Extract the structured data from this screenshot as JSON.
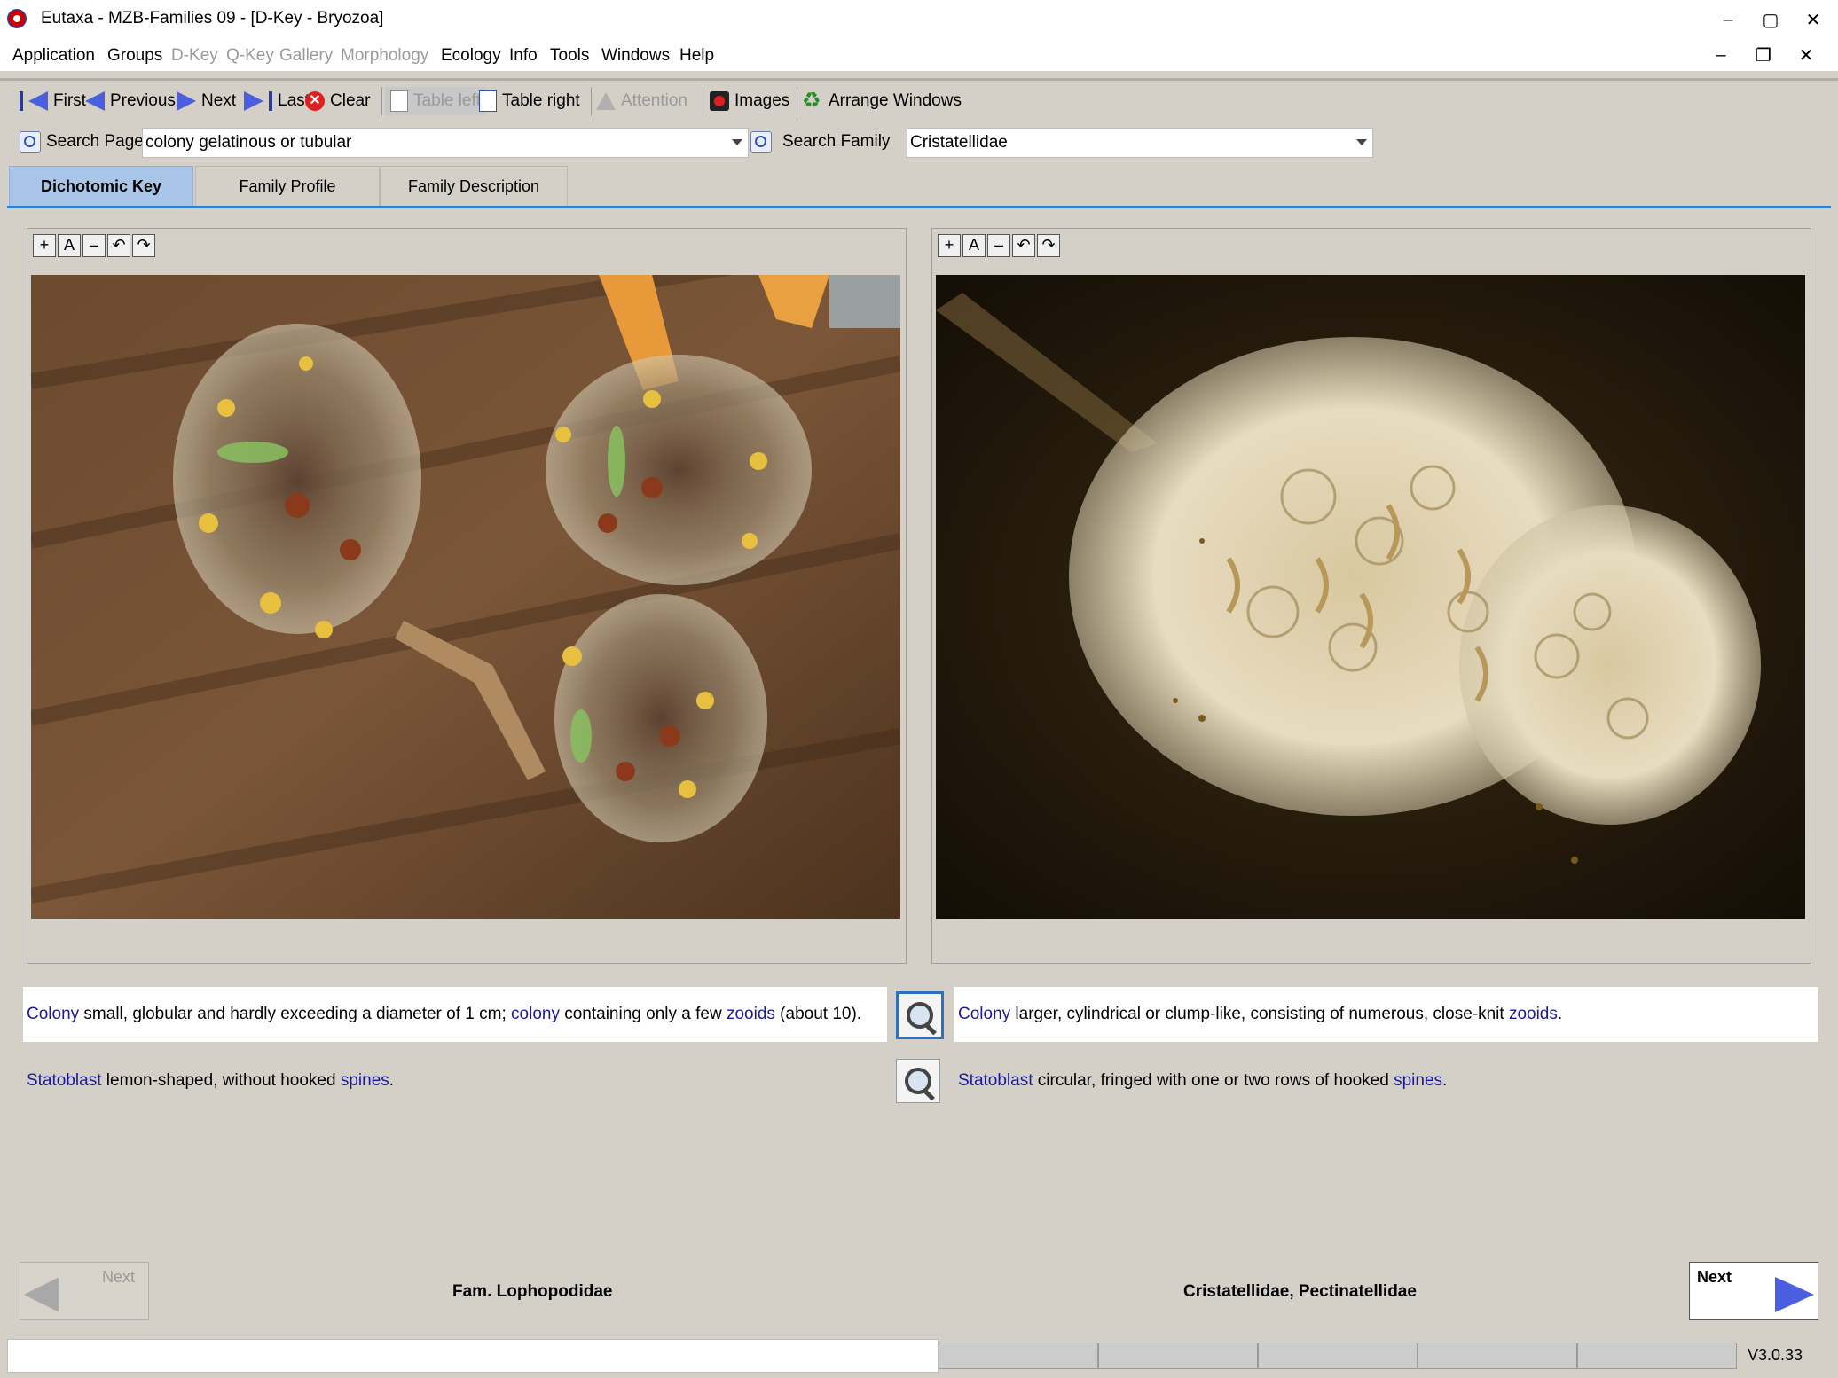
{
  "window": {
    "title": "Eutaxa - MZB-Families 09 - [D-Key - Bryozoa]",
    "minimize": "–",
    "maximize": "▢",
    "close": "✕",
    "mdi_minimize": "–",
    "mdi_restore": "❐",
    "mdi_close": "✕"
  },
  "menu": {
    "items": [
      {
        "label": "Application",
        "enabled": true
      },
      {
        "label": "Groups",
        "enabled": true
      },
      {
        "label": "D-Key",
        "enabled": false
      },
      {
        "label": "Q-Key",
        "enabled": false
      },
      {
        "label": "Gallery",
        "enabled": false
      },
      {
        "label": "Morphology",
        "enabled": false
      },
      {
        "label": "Ecology",
        "enabled": true
      },
      {
        "label": "Info",
        "enabled": true
      },
      {
        "label": "Tools",
        "enabled": true
      },
      {
        "label": "Windows",
        "enabled": true
      },
      {
        "label": "Help",
        "enabled": true
      }
    ]
  },
  "toolbar": {
    "first": "First",
    "previous": "Previous",
    "next": "Next",
    "last": "Last",
    "clear": "Clear",
    "table_left": "Table left",
    "table_right": "Table right",
    "attention": "Attention",
    "images": "Images",
    "arrange_windows": "Arrange Windows"
  },
  "search": {
    "page_label": "Search Page",
    "page_value": "colony gelatinous or tubular",
    "family_label": "Search Family",
    "family_value": "Cristatellidae"
  },
  "tabs": [
    {
      "label": "Dichotomic Key",
      "active": true
    },
    {
      "label": "Family Profile",
      "active": false
    },
    {
      "label": "Family Description",
      "active": false
    }
  ],
  "zoom_tools": [
    "+",
    "A",
    "–",
    "↶",
    "↷"
  ],
  "couplets": {
    "left": {
      "line1": [
        {
          "t": "Colony",
          "link": true
        },
        {
          "t": " small, globular and hardly exceeding a diameter of 1 cm; ",
          "link": false
        },
        {
          "t": "colony",
          "link": true
        },
        {
          "t": " containing only a few ",
          "link": false
        },
        {
          "t": "zooids",
          "link": true
        },
        {
          "t": " (about 10).",
          "link": false
        }
      ],
      "line2": [
        {
          "t": "Statoblast",
          "link": true
        },
        {
          "t": " lemon-shaped, without hooked ",
          "link": false
        },
        {
          "t": "spines",
          "link": true
        },
        {
          "t": ".",
          "link": false
        }
      ],
      "result": "Fam. Lophopodidae"
    },
    "right": {
      "line1": [
        {
          "t": "Colony",
          "link": true
        },
        {
          "t": " larger, cylindrical or clump-like, consisting of numerous, close-knit ",
          "link": false
        },
        {
          "t": "zooids",
          "link": true
        },
        {
          "t": ".",
          "link": false
        }
      ],
      "line2": [
        {
          "t": "Statoblast",
          "link": true
        },
        {
          "t": " circular, fringed with one or two rows of hooked ",
          "link": false
        },
        {
          "t": "spines",
          "link": true
        },
        {
          "t": ".",
          "link": false
        }
      ],
      "result": "Cristatellidae, Pectinatellidae"
    }
  },
  "nav": {
    "left_label": "Next",
    "right_label": "Next",
    "left_enabled": false,
    "right_enabled": true
  },
  "status": {
    "version": "V3.0.33"
  },
  "colors": {
    "link": "#1a1a99",
    "accent": "#2f7fd1",
    "tab_active": "#a9c6e8",
    "arrow": "#4a5ee0"
  }
}
